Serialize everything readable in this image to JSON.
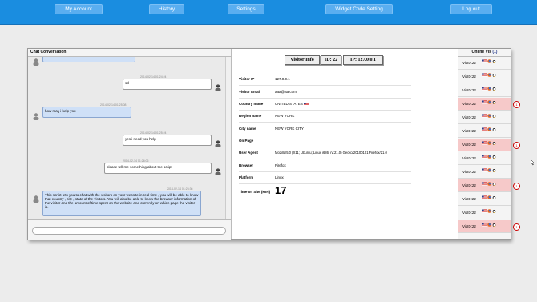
{
  "nav": [
    "My Account",
    "History",
    "Settings",
    "Widget Code Setting",
    "Log out"
  ],
  "chat": {
    "title": "Chat Conversation",
    "messages": [
      {
        "side": "out",
        "time": "2014-02-14 01:24:24",
        "text": "sd"
      },
      {
        "side": "in",
        "time": "2014-02-14 01:25:08",
        "text": "how may i help you"
      },
      {
        "side": "out",
        "time": "2014-02-14 01:25:24",
        "text": "yes i need you help"
      },
      {
        "side": "out",
        "time": "2014-02-14 01:26:06",
        "text": "please tell me something about the script"
      },
      {
        "side": "in",
        "time": "2014-02-14 01:26:36",
        "text": "This script lets you to chat with the visitors on your website in real time , you will be able to know that country , city , state of the visitors. You will also be able to know the browser information of the visitor and the amount of time spent on the website and currently on which page the visitor is."
      }
    ]
  },
  "info": {
    "visitor_info_label": "Visitor Info",
    "id_label": "ID: 22",
    "ip_label": "IP: 127.0.0.1",
    "rows": [
      {
        "k": "Visitor IP",
        "v": "127.0.0.1"
      },
      {
        "k": "Visitor Email",
        "v": "aaa@aa.com"
      },
      {
        "k": "Country name",
        "v": "UNITED STATES"
      },
      {
        "k": "Region name",
        "v": "NEW YORK"
      },
      {
        "k": "City name",
        "v": "NEW YORK CITY"
      },
      {
        "k": "On Page",
        "v": ""
      },
      {
        "k": "User Agent",
        "v": "Mozilla/5.0 (X11; Ubuntu; Linux i686; rv:21.0) Gecko/20100101 Firefox/21.0"
      },
      {
        "k": "Browser",
        "v": "Firefox"
      },
      {
        "k": "Platform",
        "v": "Linux"
      }
    ],
    "time_label": "Time on Site (MIN)",
    "time_value": "17"
  },
  "online": {
    "title": "Online Vis",
    "count": "(1)",
    "visitors": [
      {
        "label": "VisID:22",
        "hl": false,
        "badge": ""
      },
      {
        "label": "VisID:22",
        "hl": false,
        "badge": ""
      },
      {
        "label": "VisID:22",
        "hl": false,
        "badge": ""
      },
      {
        "label": "VisID:22",
        "hl": true,
        "badge": "1"
      },
      {
        "label": "VisID:22",
        "hl": false,
        "badge": ""
      },
      {
        "label": "VisID:22",
        "hl": false,
        "badge": ""
      },
      {
        "label": "VisID:22",
        "hl": true,
        "badge": "1"
      },
      {
        "label": "VisID:22",
        "hl": false,
        "badge": ""
      },
      {
        "label": "VisID:22",
        "hl": false,
        "badge": ""
      },
      {
        "label": "VisID:22",
        "hl": true,
        "badge": "1"
      },
      {
        "label": "VisID:22",
        "hl": false,
        "badge": ""
      },
      {
        "label": "VisID:22",
        "hl": false,
        "badge": ""
      },
      {
        "label": "VisID:22",
        "hl": true,
        "badge": "1"
      }
    ]
  },
  "colors": {
    "topbar": "#1a8de0",
    "nav_button": "#5aaef0",
    "incoming_msg": "#cfe0f7",
    "highlight_row": "#f6c9c9"
  }
}
